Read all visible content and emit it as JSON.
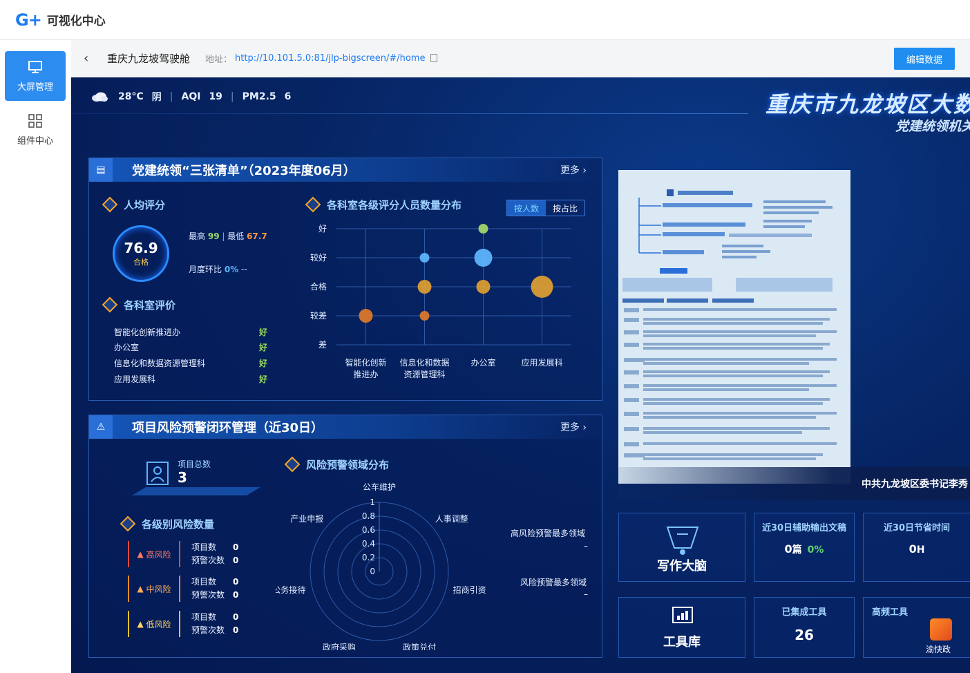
{
  "app": {
    "logo": "G+",
    "title": "可视化中心"
  },
  "sidebar": {
    "items": [
      {
        "label": "大屏管理",
        "icon": "monitor-icon"
      },
      {
        "label": "组件中心",
        "icon": "grid-icon"
      }
    ]
  },
  "toolbar": {
    "page_name": "重庆九龙坡驾驶舱",
    "address_label": "地址：",
    "address_url": "http://10.101.5.0:81/jlp-bigscreen/#/home",
    "edit_label": "编辑数据"
  },
  "weather": {
    "temp": "28°C",
    "cond": "阴",
    "aqi_label": "AQI",
    "aqi": "19",
    "pm_label": "PM2.5",
    "pm": "6"
  },
  "screen_title": {
    "main": "重庆市九龙坡区大数",
    "sub": "党建统领机关"
  },
  "panel1": {
    "title": "党建统领“三张清单”（2023年度06月）",
    "more": "更多",
    "avg_score": {
      "title": "人均评分",
      "value": "76.9",
      "grade": "合格",
      "max_label": "最高",
      "max": "99",
      "min_label": "最低",
      "min": "67.7",
      "mom_label": "月度环比",
      "mom": "0%",
      "mom_tail": "--"
    },
    "dept_eval": {
      "title": "各科室评价",
      "rows": [
        {
          "name": "智能化创新推进办",
          "grade": "好"
        },
        {
          "name": "办公室",
          "grade": "好"
        },
        {
          "name": "信息化和数据资源管理科",
          "grade": "好"
        },
        {
          "name": "应用发展科",
          "grade": "好"
        }
      ]
    },
    "dist": {
      "title": "各科室各级评分人员数量分布",
      "toggle_on": "按人数",
      "toggle_off": "按占比"
    }
  },
  "panel2": {
    "title": "项目风险预警闭环管理（近30日）",
    "more": "更多",
    "total_label": "项目总数",
    "total": "3",
    "risk_title": "各级别风险数量",
    "risks": [
      {
        "level": "高风险",
        "color": "#e04b3a",
        "items_label": "项目数",
        "warn_label": "预警次数",
        "items": "0",
        "warn": "0"
      },
      {
        "level": "中风险",
        "color": "#f58a2a",
        "items_label": "项目数",
        "warn_label": "预警次数",
        "items": "0",
        "warn": "0"
      },
      {
        "level": "低风险",
        "color": "#f5c02a",
        "items_label": "项目数",
        "warn_label": "预警次数",
        "items": "0",
        "warn": "0"
      }
    ],
    "radar_title": "风险预警领域分布",
    "high_label": "高风险预警最多领域",
    "high_val": "–",
    "warn_label": "风险预警最多领域",
    "warn_val": "–"
  },
  "doc": {
    "caption": "中共九龙坡区委书记李秀"
  },
  "cards": {
    "writing": {
      "label": "写作大脑"
    },
    "output": {
      "title": "近30日辅助输出文稿",
      "value": "0",
      "unit": "篇",
      "pct": "0%"
    },
    "saving": {
      "title": "近30日节省时间",
      "value": "0",
      "unit": "H"
    },
    "tools": {
      "label": "工具库"
    },
    "integrated": {
      "title": "已集成工具",
      "value": "26"
    },
    "frequent": {
      "title": "高频工具",
      "app": "渝快政"
    }
  },
  "chart_data": [
    {
      "type": "scatter",
      "title": "各科室各级评分人员数量分布",
      "categories": [
        "智能化创新推进办",
        "信息化和数据资源管理科",
        "办公室",
        "应用发展科"
      ],
      "category_labels": [
        [
          "智能化创新",
          "推进办"
        ],
        [
          "信息化和数据",
          "资源管理科"
        ],
        [
          "办公室"
        ],
        [
          "应用发展科"
        ]
      ],
      "y_levels": [
        "差",
        "较差",
        "合格",
        "较好",
        "好"
      ],
      "points": [
        {
          "x": "智能化创新推进办",
          "y": "较差",
          "size": 2,
          "color": "#e07a2a"
        },
        {
          "x": "信息化和数据资源管理科",
          "y": "较好",
          "size": 1,
          "color": "#5fb8ff"
        },
        {
          "x": "信息化和数据资源管理科",
          "y": "合格",
          "size": 2,
          "color": "#e0a030"
        },
        {
          "x": "信息化和数据资源管理科",
          "y": "较差",
          "size": 1,
          "color": "#e07a2a"
        },
        {
          "x": "办公室",
          "y": "好",
          "size": 1,
          "color": "#a6d96a"
        },
        {
          "x": "办公室",
          "y": "较好",
          "size": 3,
          "color": "#5fb8ff"
        },
        {
          "x": "办公室",
          "y": "合格",
          "size": 2,
          "color": "#e0a030"
        },
        {
          "x": "应用发展科",
          "y": "合格",
          "size": 4,
          "color": "#e0a030"
        }
      ]
    },
    {
      "type": "radar",
      "title": "风险预警领域分布",
      "axes": [
        "公车维护",
        "人事调整",
        "招商引资",
        "政策兑付",
        "政府采购",
        "公务接待",
        "产业申报"
      ],
      "ticks": [
        "0",
        "0.2",
        "0.4",
        "0.6",
        "0.8",
        "1"
      ],
      "range": [
        0,
        1
      ],
      "values": [
        0,
        0,
        0,
        0,
        0,
        0,
        0
      ]
    }
  ]
}
